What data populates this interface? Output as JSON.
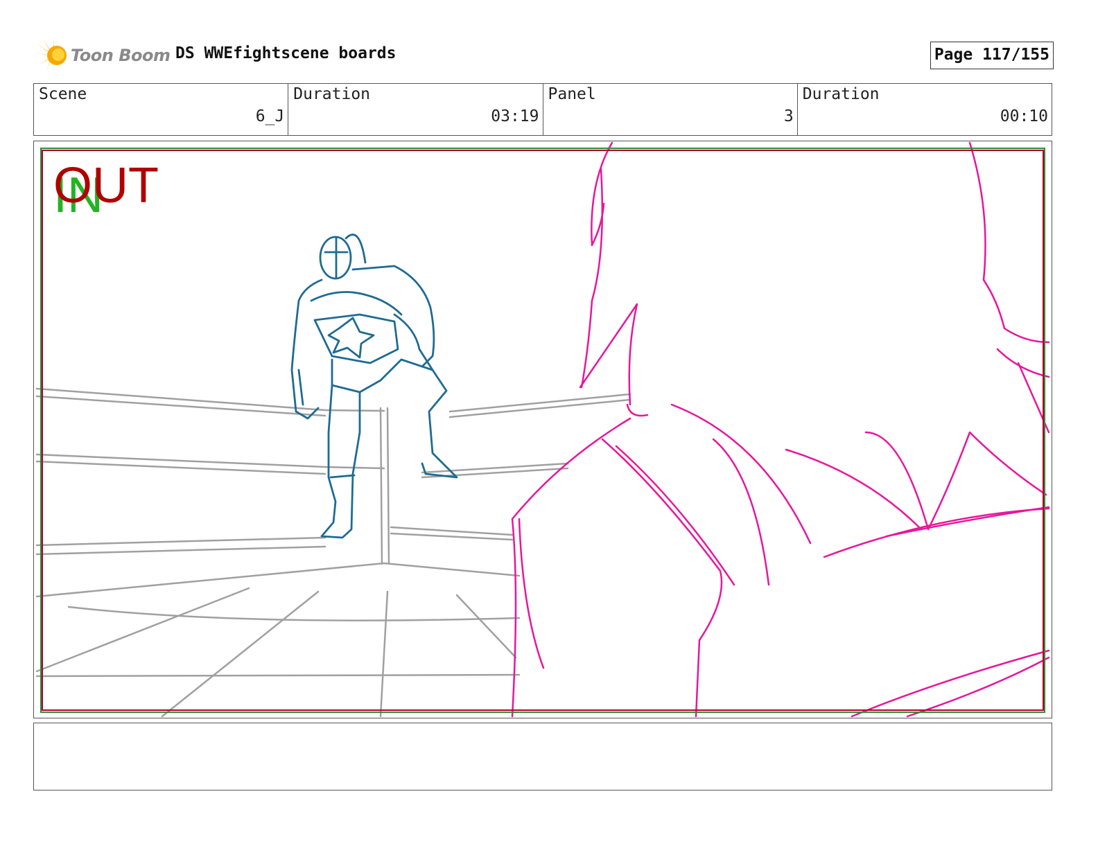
{
  "header": {
    "logo_text": "Toon Boom",
    "title": "DS WWEfightscene boards",
    "page_label": "Page 117/155"
  },
  "info": [
    {
      "label": "Scene",
      "value": "6_J"
    },
    {
      "label": "Duration",
      "value": "03:19"
    },
    {
      "label": "Panel",
      "value": "3"
    },
    {
      "label": "Duration",
      "value": "00:10"
    }
  ],
  "frame": {
    "in_marker": "IN",
    "out_marker": "OUT"
  },
  "notes": {
    "text": ""
  },
  "colors": {
    "safe_area_green": "#2e8b3a",
    "frame_red": "#b0002a",
    "wrestler_sketch": "#1e6b93",
    "foreground_sketch": "#e8169a",
    "ring_sketch": "#a0a0a0",
    "logo_flare": "#f5c518"
  }
}
